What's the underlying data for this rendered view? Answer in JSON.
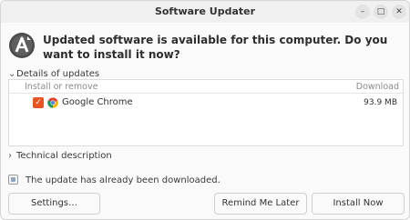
{
  "window": {
    "title": "Software Updater",
    "controls": {
      "minimize": "–",
      "maximize": "□",
      "close": "✕"
    }
  },
  "header": {
    "icon": "software-updater-icon",
    "message": "Updated software is available for this computer. Do you want to install it now?"
  },
  "details": {
    "expander_label": "Details of updates",
    "expanded": true,
    "columns": {
      "left": "Install or remove",
      "right": "Download"
    },
    "updates": [
      {
        "checked": true,
        "icon": "google-chrome-icon",
        "name": "Google Chrome",
        "size": "93.9 MB"
      }
    ]
  },
  "technical": {
    "expander_label": "Technical description",
    "expanded": false
  },
  "status": {
    "text": "The update has already been downloaded."
  },
  "buttons": {
    "settings": "Settings…",
    "remind": "Remind Me Later",
    "install": "Install Now"
  },
  "colors": {
    "accent": "#e95420",
    "window_bg": "#fafafa",
    "list_bg": "#ffffff"
  }
}
